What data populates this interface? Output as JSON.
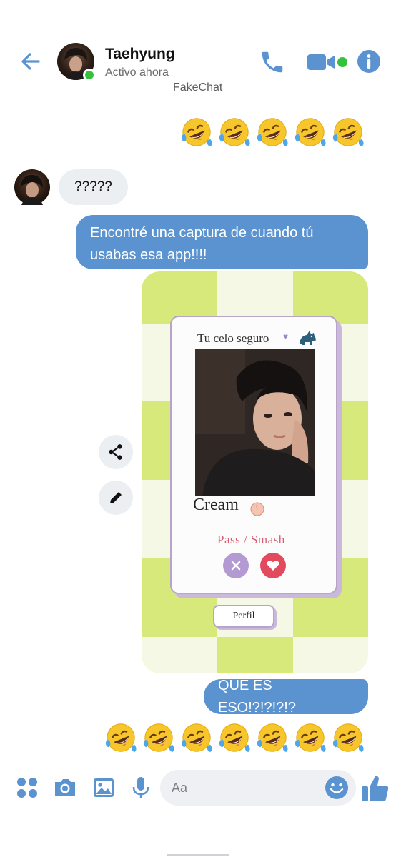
{
  "header": {
    "contact_name": "Taehyung",
    "status": "Activo ahora",
    "watermark": "FakeChat"
  },
  "colors": {
    "accent": "#5a93cf",
    "online": "#35c13c",
    "incoming_bubble": "#eceff1",
    "checker_light": "#f5f8e4",
    "checker_lime": "#d7e97a",
    "card_border": "#b7a4c8",
    "pass_button": "#b49ad3",
    "smash_button": "#e24b5e"
  },
  "messages": [
    {
      "type": "emoji",
      "direction": "outgoing",
      "emoji": "rolling-on-floor-laughing",
      "count": 5
    },
    {
      "type": "text",
      "direction": "incoming",
      "text": "?????"
    },
    {
      "type": "text",
      "direction": "outgoing",
      "text": "Encontré una captura de cuando tú usabas esa app!!!!"
    },
    {
      "type": "image",
      "direction": "outgoing"
    },
    {
      "type": "text",
      "direction": "outgoing",
      "text": "QUE ES ESO!?!?!?!?"
    },
    {
      "type": "emoji",
      "direction": "outgoing",
      "emoji": "rolling-on-floor-laughing",
      "count": 7
    }
  ],
  "image_card": {
    "header": "Tu celo seguro",
    "name": "Cream",
    "actions_label": "Pass  /  Smash",
    "profile_button": "Perfil"
  },
  "composer": {
    "placeholder": "Aa"
  },
  "icons": {
    "back": "arrow-left-icon",
    "call": "phone-icon",
    "video": "video-camera-icon",
    "info": "info-icon",
    "share": "share-icon",
    "edit": "pencil-icon",
    "apps": "four-dots-icon",
    "camera": "camera-icon",
    "gallery": "image-icon",
    "mic": "microphone-icon",
    "emoji": "smiley-icon",
    "like": "thumbs-up-icon"
  }
}
